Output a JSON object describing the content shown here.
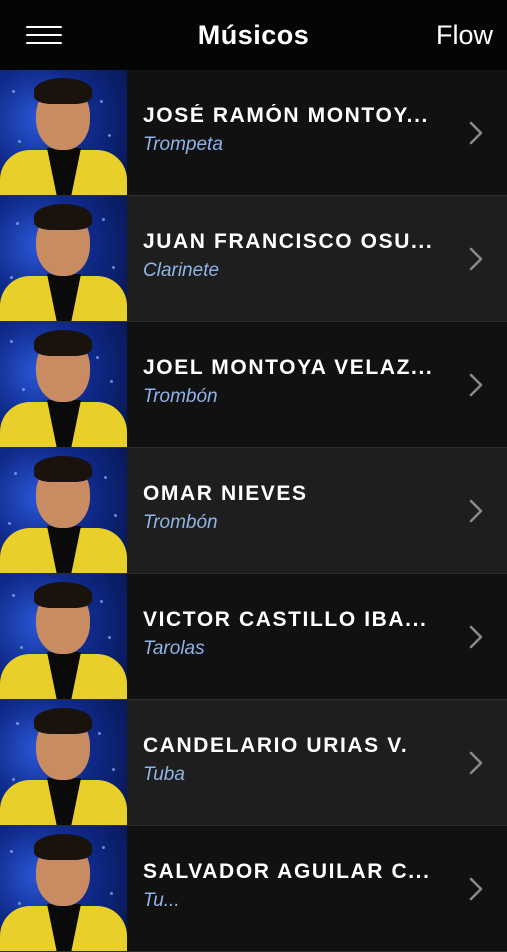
{
  "navbar": {
    "title": "Músicos",
    "right_label": "Flow",
    "menu_icon": "hamburger-menu-icon"
  },
  "musicians": [
    {
      "name": "JOSÉ RAMÓN MONTOY...",
      "instrument": "Trompeta"
    },
    {
      "name": "JUAN FRANCISCO OSU...",
      "instrument": "Clarinete"
    },
    {
      "name": "JOEL MONTOYA VELAZ...",
      "instrument": "Trombón"
    },
    {
      "name": "OMAR NIEVES",
      "instrument": "Trombón"
    },
    {
      "name": "VICTOR CASTILLO IBA...",
      "instrument": "Tarolas"
    },
    {
      "name": "CANDELARIO URIAS V.",
      "instrument": "Tuba"
    },
    {
      "name": "SALVADOR AGUILAR C...",
      "instrument": "Tu..."
    }
  ],
  "colors": {
    "navbar_bg": "#050505",
    "row_odd": "#111111",
    "row_even": "#1e1e1e",
    "instrument_text": "#8fb4e8",
    "jacket": "#e8cf2a"
  },
  "icons": {
    "row_arrow": "chevron-right-icon",
    "photo": "musician-photo"
  }
}
